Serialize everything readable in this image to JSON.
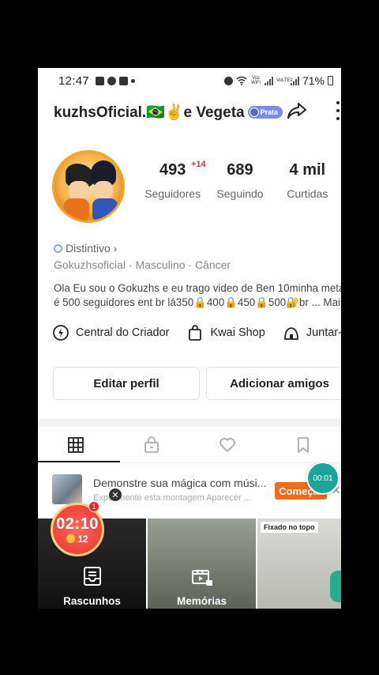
{
  "status_bar": {
    "time": "12:47",
    "battery": "71%",
    "net1": "Voz WiFi",
    "net2": "VoLTE2"
  },
  "header": {
    "username": "kuzhsOficial.🇧🇷✌️e Vegeta",
    "badge": "Prata"
  },
  "stats": {
    "followers": {
      "value": "493",
      "label": "Seguidores",
      "new": "+14"
    },
    "following": {
      "value": "689",
      "label": "Seguindo"
    },
    "likes": {
      "value": "4 mil",
      "label": "Curtidas"
    }
  },
  "profile": {
    "distintivo": "Distintivo ›",
    "info": "Gokuzhsoficial · Masculino · Câncer",
    "bio_line1": "Ola Eu sou o Gokuzhs e eu trago video de Ben 10minha meta",
    "bio_line2": "é 500 seguidores ent br lá350🔒400🔒450🔒500🔐br ...  Mais"
  },
  "tools": {
    "creator": "Central do Criador",
    "shop": "Kwai Shop",
    "join": "Juntar-se"
  },
  "buttons": {
    "edit": "Editar perfil",
    "add": "Adicionar amigos"
  },
  "promo": {
    "title": "Demonstre sua mágica com músi...",
    "subtitle": "Experimente esta montagem Aparecer ...",
    "cta": "Começar"
  },
  "timer": "00:01",
  "live": {
    "time": "02:10",
    "coins": "12",
    "badge": "1"
  },
  "grid": {
    "drafts": "Rascunhos",
    "memories": "Memórias",
    "pinned": "Fixado no topo"
  },
  "colors": {
    "accent": "#f26a1b",
    "live": "#f2473d",
    "timer": "#1aa79a",
    "badge": "#7a8ae6"
  }
}
